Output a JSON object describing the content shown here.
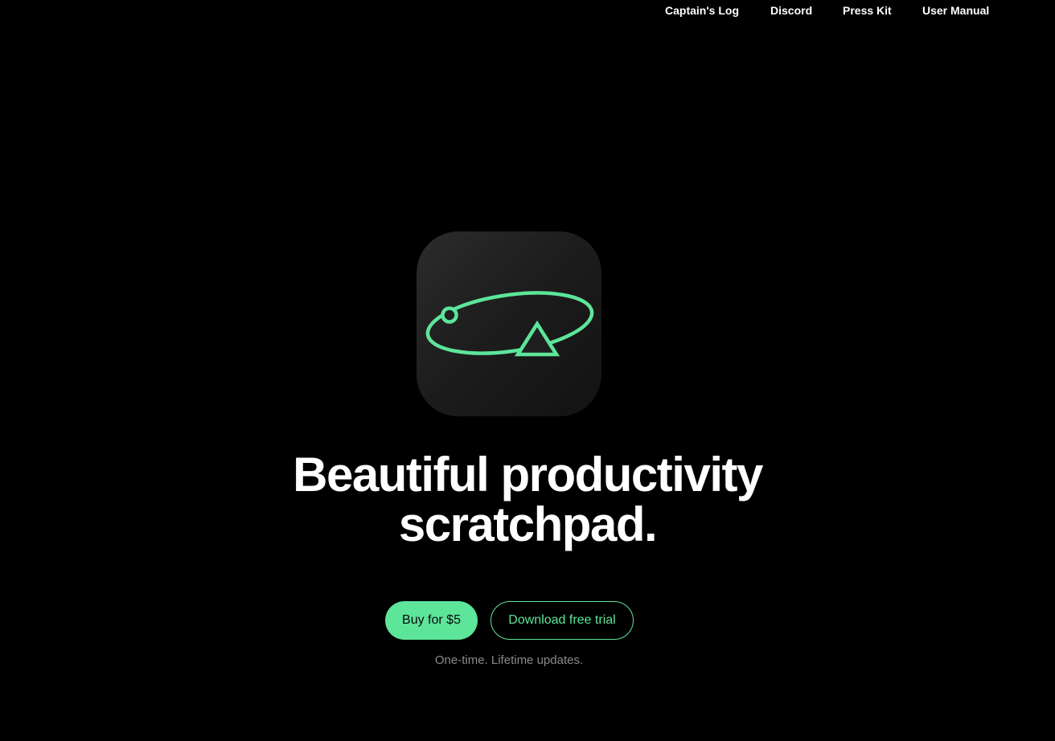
{
  "nav": {
    "items": [
      {
        "label": "Captain's Log"
      },
      {
        "label": "Discord"
      },
      {
        "label": "Press Kit"
      },
      {
        "label": "User Manual"
      }
    ]
  },
  "hero": {
    "icon": "orbit-triangle-app-icon",
    "headline_line1": "Beautiful productivity",
    "headline_line2": "scratchpad.",
    "buy_label": "Buy for $5",
    "trial_label": "Download free trial",
    "note": "One-time. Lifetime updates."
  },
  "colors": {
    "background": "#000000",
    "accent": "#5de59a",
    "text": "#ffffff",
    "muted": "#8a8a8a"
  }
}
